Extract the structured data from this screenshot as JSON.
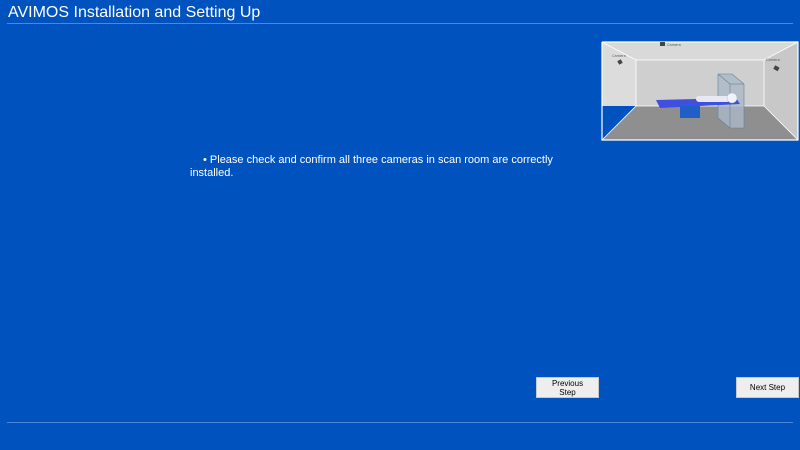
{
  "window": {
    "title": "AVIMOS Installation and Setting Up"
  },
  "instruction": {
    "line1": "• Please check and confirm all three cameras in scan room are correctly",
    "line2": "installed."
  },
  "diagram": {
    "camera_labels": [
      "Camera",
      "Camera",
      "Camera"
    ]
  },
  "buttons": {
    "previous": "Previous Step",
    "next": "Next Step"
  },
  "colors": {
    "background": "#0052bf",
    "rule": "#4b88d9",
    "button_face": "#eeeeee"
  }
}
